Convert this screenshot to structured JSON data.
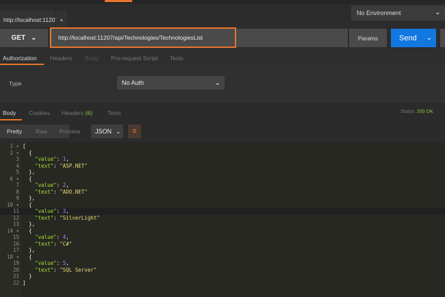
{
  "tabs": {
    "active_label": "http://localhost:11207",
    "close": "✕",
    "new": "+"
  },
  "environment": {
    "selected": "No Environment"
  },
  "request": {
    "method": "GET",
    "url": "http://localhost:11207/api/Technologies/TechnologiesList",
    "params_label": "Params",
    "send_label": "Send"
  },
  "request_tabs": [
    "Authorization",
    "Headers",
    "Body",
    "Pre-request Script",
    "Tests"
  ],
  "auth": {
    "type_label": "Type",
    "type_value": "No Auth"
  },
  "response_tabs": {
    "body": "Body",
    "cookies": "Cookies",
    "headers": "Headers",
    "headers_count": "(6)",
    "tests": "Tests"
  },
  "status": {
    "label": "Status:",
    "value": "200 OK",
    "color": "#8cc63f"
  },
  "format": {
    "pretty": "Pretty",
    "raw": "Raw",
    "preview": "Preview",
    "type": "JSON"
  },
  "colors": {
    "accent": "#e8762c",
    "send": "#1377e0"
  },
  "response_body": [
    {
      "value": 1,
      "text": "ASP.NET"
    },
    {
      "value": 2,
      "text": "ADO.NET"
    },
    {
      "value": 3,
      "text": "SilverLight"
    },
    {
      "value": 4,
      "text": "C#"
    },
    {
      "value": 5,
      "text": "SQL Server"
    }
  ]
}
